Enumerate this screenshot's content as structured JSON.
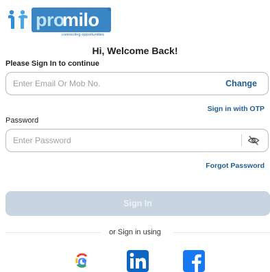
{
  "brand": {
    "name_part1": "pro",
    "name_part2": "milo",
    "trademark": "®",
    "tagline": "connecting opportunities"
  },
  "heading": "Hi, Welcome Back!",
  "subheading": "Please Sign In to continue",
  "email": {
    "placeholder": "Enter Email Or Mob No.",
    "value": "",
    "action_label": "Change"
  },
  "sign_in_otp_label": "Sign in with OTP",
  "password": {
    "label": "Password",
    "placeholder": "Enter Password",
    "value": "",
    "toggle_icon": "eye-off-icon"
  },
  "forgot_password_label": "Forgot Password",
  "sign_in_button_label": "Sign In",
  "divider_text": "or Sign in using",
  "social": [
    {
      "name": "Google",
      "icon": "google-icon"
    },
    {
      "name": "LinkedIn",
      "icon": "linkedin-icon"
    },
    {
      "name": "Facebook",
      "icon": "facebook-icon"
    }
  ],
  "colors": {
    "brand_blue": "#3a86c4",
    "link_blue": "#1e5e94",
    "button_disabled": "#c9d4e1",
    "linkedin": "#0a66c2",
    "facebook": "#1877f2"
  }
}
